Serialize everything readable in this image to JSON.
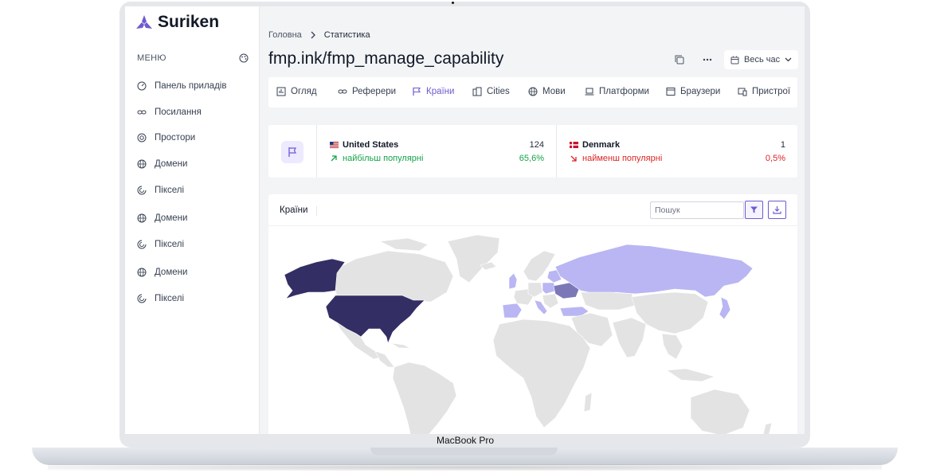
{
  "device": {
    "label": "MacBook Pro"
  },
  "app": {
    "name": "Suriken",
    "accent": "#6d5bd0"
  },
  "sidebar": {
    "menu_title": "МЕНЮ",
    "items": [
      {
        "label": "Панель приладів",
        "icon": "dashboard-icon"
      },
      {
        "label": "Посилання",
        "icon": "link-icon"
      },
      {
        "label": "Простори",
        "icon": "target-icon"
      },
      {
        "label": "Домени",
        "icon": "globe-icon"
      },
      {
        "label": "Пікселі",
        "icon": "pixel-icon"
      },
      {
        "label": "Домени",
        "icon": "globe-icon"
      },
      {
        "label": "Пікселі",
        "icon": "pixel-icon"
      },
      {
        "label": "Домени",
        "icon": "globe-icon"
      },
      {
        "label": "Пікселі",
        "icon": "pixel-icon"
      }
    ]
  },
  "breadcrumb": {
    "home": "Головна",
    "current": "Статистика"
  },
  "page": {
    "title": "fmp.ink/fmp_manage_capability",
    "date_range": "Весь час"
  },
  "tabs": [
    {
      "label": "Огляд",
      "icon": "bar-chart-icon",
      "active": false
    },
    {
      "label": "Реферери",
      "icon": "link-icon",
      "active": false
    },
    {
      "label": "Країни",
      "icon": "flag-icon",
      "active": true
    },
    {
      "label": "Cities",
      "icon": "city-icon",
      "active": false
    },
    {
      "label": "Мови",
      "icon": "globe-icon",
      "active": false
    },
    {
      "label": "Платформи",
      "icon": "laptop-icon",
      "active": false
    },
    {
      "label": "Браузери",
      "icon": "browser-icon",
      "active": false
    },
    {
      "label": "Пристрої",
      "icon": "devices-icon",
      "active": false
    }
  ],
  "stats": {
    "most": {
      "country": "United States",
      "count": "124",
      "caption": "найбільш популярні",
      "percent": "65,6%",
      "color": "#16a34a"
    },
    "least": {
      "country": "Denmark",
      "count": "1",
      "caption": "найменш популярні",
      "percent": "0,5%",
      "color": "#dc2626"
    }
  },
  "map_panel": {
    "title": "Країни",
    "search_placeholder": "Пошук",
    "colors": {
      "top": "#332e63",
      "mid": "#7c78b8",
      "low": "#b9b6f3",
      "none": "#e3e3e3"
    }
  }
}
